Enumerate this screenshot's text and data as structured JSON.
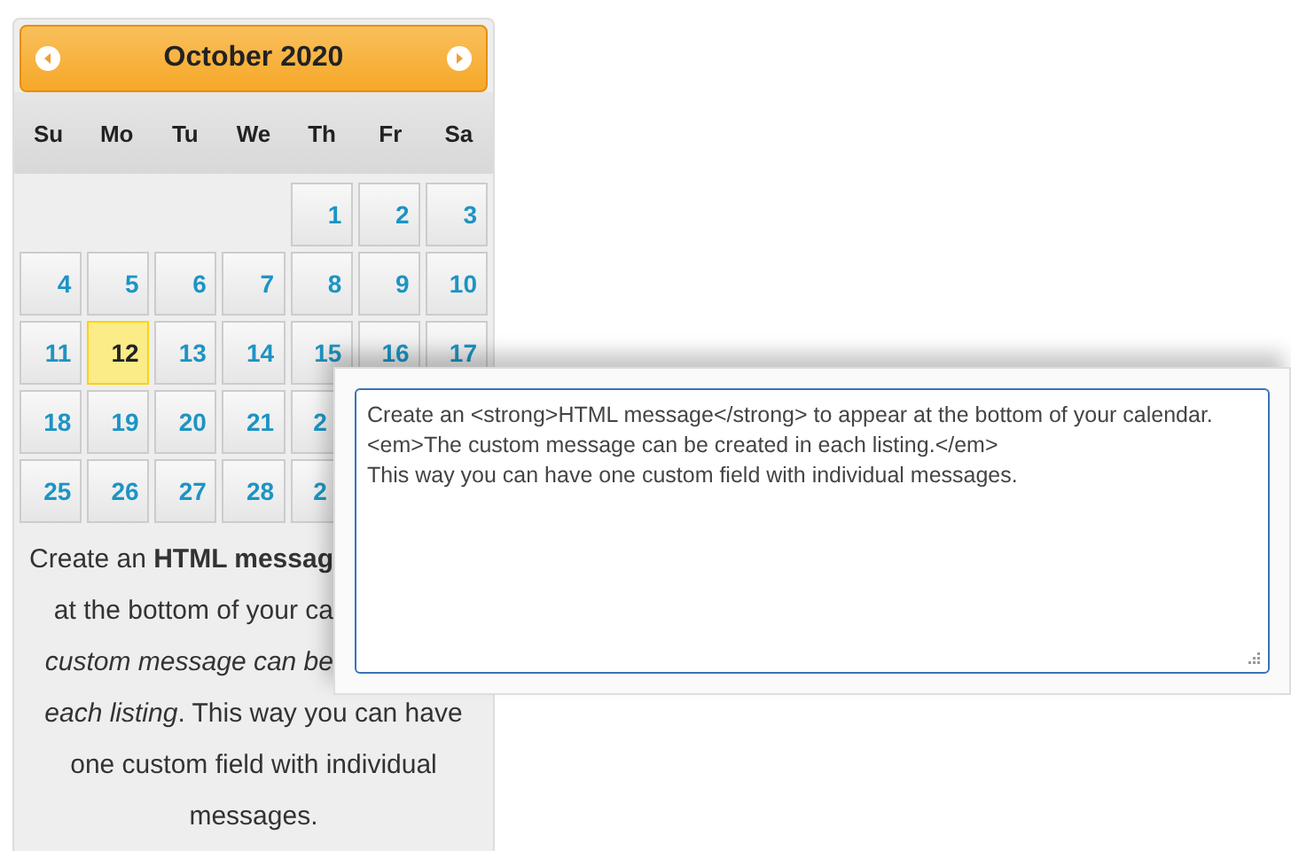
{
  "calendar": {
    "title": "October 2020",
    "weekdays": [
      "Su",
      "Mo",
      "Tu",
      "We",
      "Th",
      "Fr",
      "Sa"
    ],
    "weeks": [
      {
        "kind": "end",
        "days": [
          {
            "day": "1",
            "kind": "day",
            "selected": false
          },
          {
            "day": "2",
            "kind": "day",
            "selected": false
          },
          {
            "day": "3",
            "kind": "day",
            "selected": false
          }
        ]
      },
      {
        "kind": "start",
        "days": [
          {
            "day": "4",
            "kind": "day",
            "selected": false
          },
          {
            "day": "5",
            "kind": "day",
            "selected": false
          },
          {
            "day": "6",
            "kind": "day",
            "selected": false
          },
          {
            "day": "7",
            "kind": "day",
            "selected": false
          },
          {
            "day": "8",
            "kind": "day",
            "selected": false
          },
          {
            "day": "9",
            "kind": "day",
            "selected": false
          },
          {
            "day": "10",
            "kind": "day",
            "selected": false
          }
        ]
      },
      {
        "kind": "start",
        "days": [
          {
            "day": "11",
            "kind": "day",
            "selected": false
          },
          {
            "day": "12",
            "kind": "day",
            "selected": true
          },
          {
            "day": "13",
            "kind": "day",
            "selected": false
          },
          {
            "day": "14",
            "kind": "day",
            "selected": false
          },
          {
            "day": "15",
            "kind": "day",
            "selected": false
          },
          {
            "day": "16",
            "kind": "day",
            "selected": false
          },
          {
            "day": "17",
            "kind": "day",
            "selected": false
          }
        ]
      },
      {
        "kind": "start",
        "days": [
          {
            "day": "18",
            "kind": "day",
            "selected": false
          },
          {
            "day": "19",
            "kind": "day",
            "selected": false
          },
          {
            "day": "20",
            "kind": "day",
            "selected": false
          },
          {
            "day": "21",
            "kind": "day",
            "selected": false
          },
          {
            "day": "2",
            "kind": "cut",
            "selected": false
          }
        ]
      },
      {
        "kind": "start",
        "days": [
          {
            "day": "25",
            "kind": "day",
            "selected": false
          },
          {
            "day": "26",
            "kind": "day",
            "selected": false
          },
          {
            "day": "27",
            "kind": "day",
            "selected": false
          },
          {
            "day": "28",
            "kind": "day",
            "selected": false
          },
          {
            "day": "2",
            "kind": "cut",
            "selected": false
          }
        ]
      }
    ],
    "message_lines": [
      {
        "text": "Create an **HTML messag**",
        "kind": "cut"
      },
      {
        "text": "at the bottom of your ca",
        "kind": "cut"
      },
      {
        "text": "*custom message can be*",
        "kind": "cut"
      },
      {
        "text": "*each listing*. This way you can have",
        "kind": "whole"
      },
      {
        "text": "one custom field with individual",
        "kind": "whole"
      },
      {
        "text": "messages.",
        "kind": "whole"
      }
    ]
  },
  "editor": {
    "value": "Create an <strong>HTML message</strong> to appear at the bottom of your calendar.\n<em>The custom message can be created in each listing.</em>\nThis way you can have one custom field with individual messages."
  }
}
